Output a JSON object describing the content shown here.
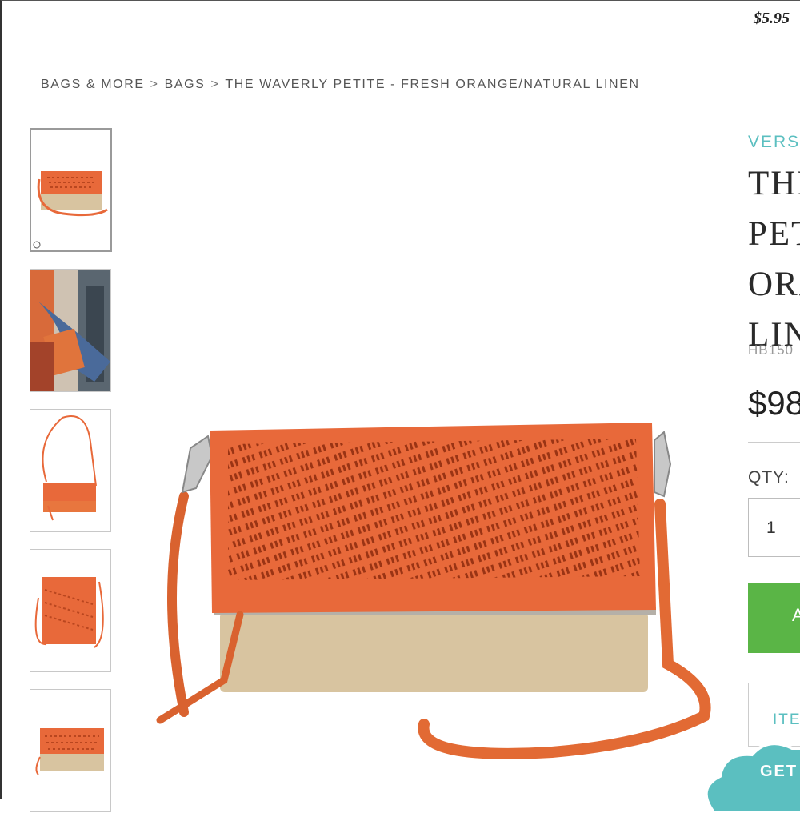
{
  "promo": {
    "price_text": "$5.95"
  },
  "breadcrumb": {
    "items": [
      "BAGS & MORE",
      "BAGS",
      "THE WAVERLY PETITE - FRESH ORANGE/NATURAL LINEN"
    ],
    "separator": ">"
  },
  "product": {
    "collection": "VERS",
    "title_lines": [
      "THE",
      "PET",
      "ORA",
      "LIN"
    ],
    "sku": "HB150",
    "price": "$98",
    "qty_label": "QTY:",
    "qty_value": "1",
    "add_button_label": "A",
    "item_button_label": "ITE"
  },
  "chat": {
    "label": "GET"
  },
  "colors": {
    "accent_teal": "#5bbfc0",
    "button_green": "#5ab546",
    "bag_orange": "#e8693a",
    "linen": "#d8c4a0"
  },
  "thumbnails": [
    "bag-front",
    "model-wearing-bag",
    "bag-crossbody-strap",
    "bag-unfolded",
    "bag-folded"
  ]
}
